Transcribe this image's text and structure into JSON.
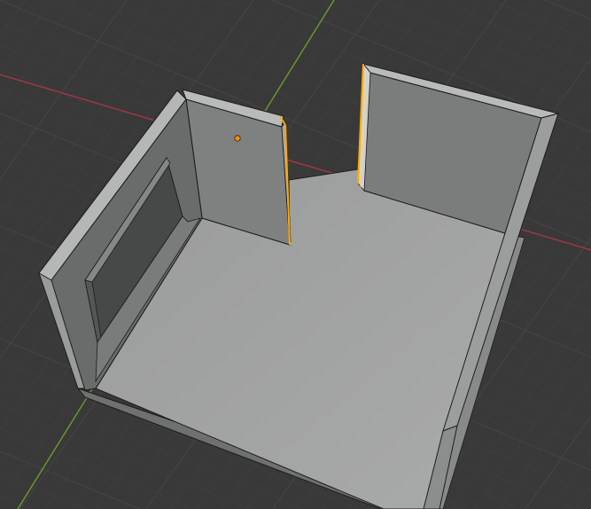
{
  "viewport": {
    "view": "3D Viewport",
    "shading": "solid",
    "colors": {
      "background": "#393939",
      "grid_minor": "#414141",
      "grid_major": "#4a4a4a",
      "x_axis": "#a63645",
      "y_axis": "#6e9a2c",
      "selected_edge": "#ffaa00",
      "active_vertex": "#ff8c00",
      "floor_top": "#a5a6a6",
      "wall_inner": "#7b7d7d",
      "wall_top": "#b9baba",
      "wall_outer": "#5c5e5e",
      "edge_wire": "#1c1c1c"
    }
  },
  "scene": {
    "object": "room",
    "mode": "edit",
    "selection": {
      "edges_selected": 2,
      "vertices_active": 1
    }
  }
}
